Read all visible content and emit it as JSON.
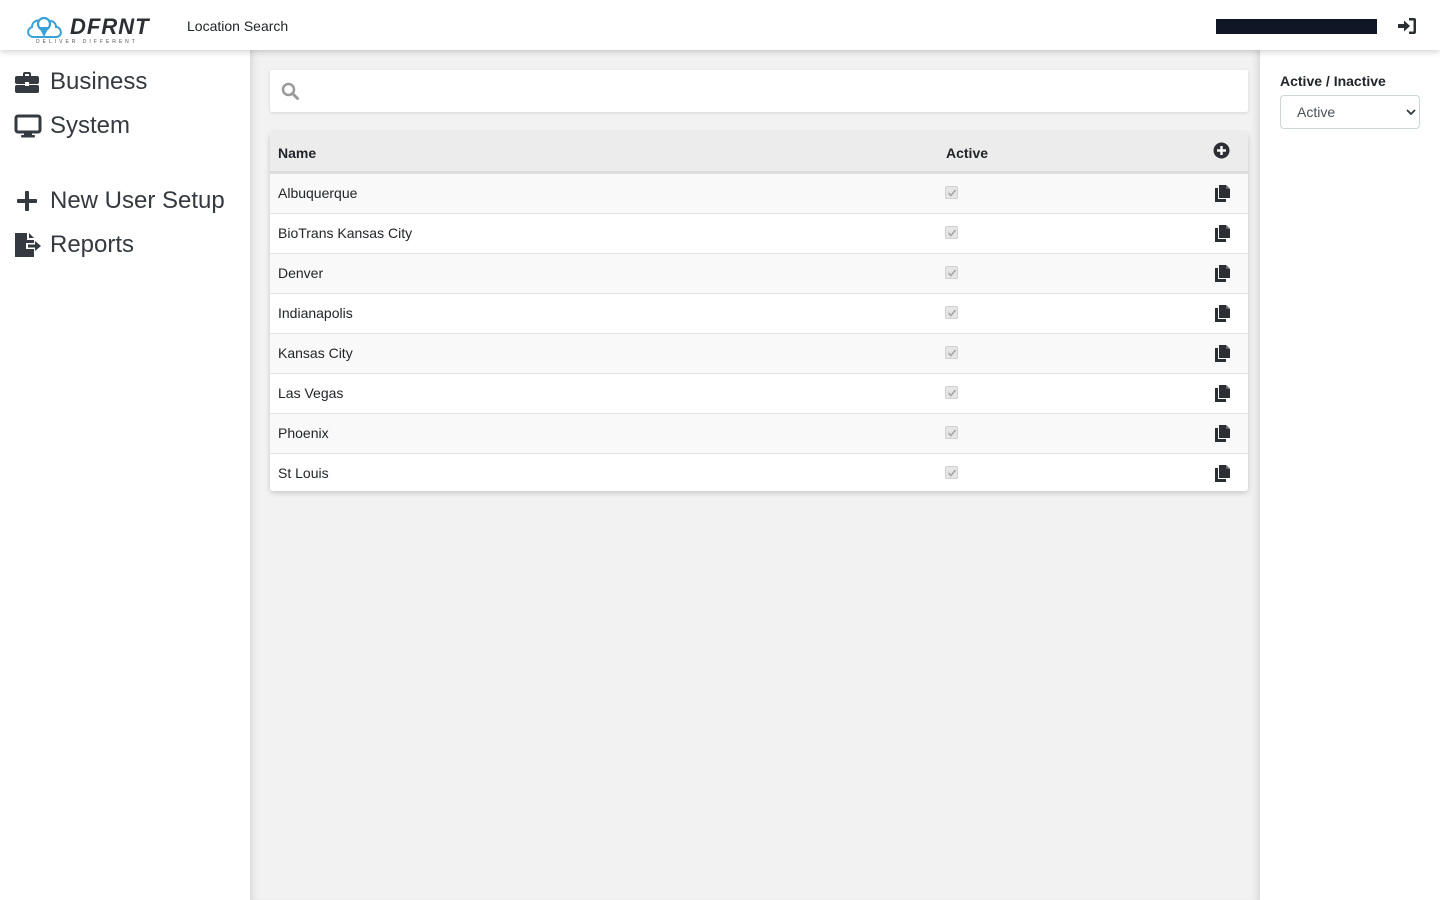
{
  "header": {
    "logo_text": "DFRNT",
    "logo_tagline": "DELIVER DIFFERENT",
    "page_title": "Location Search"
  },
  "sidebar": {
    "items": [
      {
        "label": "Business",
        "icon": "briefcase-icon"
      },
      {
        "label": "System",
        "icon": "monitor-icon"
      },
      {
        "label": "New User Setup",
        "icon": "plus-icon"
      },
      {
        "label": "Reports",
        "icon": "file-export-icon"
      }
    ]
  },
  "search": {
    "placeholder": "",
    "value": ""
  },
  "table": {
    "columns": {
      "name": "Name",
      "active": "Active"
    },
    "rows": [
      {
        "name": "Albuquerque",
        "active": true
      },
      {
        "name": "BioTrans Kansas City",
        "active": true
      },
      {
        "name": "Denver",
        "active": true
      },
      {
        "name": "Indianapolis",
        "active": true
      },
      {
        "name": "Kansas City",
        "active": true
      },
      {
        "name": "Las Vegas",
        "active": true
      },
      {
        "name": "Phoenix",
        "active": true
      },
      {
        "name": "St Louis",
        "active": true
      }
    ]
  },
  "filter": {
    "label": "Active / Inactive",
    "selected": "Active"
  },
  "colors": {
    "user_bar": "#0f1626",
    "logo_blue": "#3aa0d8",
    "text_dark": "#212529"
  }
}
